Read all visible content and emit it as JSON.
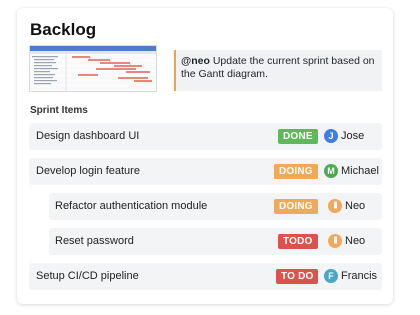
{
  "header": {
    "title": "Backlog"
  },
  "note": {
    "mention": "@neo",
    "text": " Update the current sprint based on the Gantt diagram."
  },
  "section": {
    "title": "Sprint Items"
  },
  "items": [
    {
      "label": "Design dashboard UI",
      "status": "DONE",
      "avatar": "J",
      "assignee": "Jose"
    },
    {
      "label": "Develop login feature",
      "status": "DOING",
      "avatar": "M",
      "assignee": "Michael"
    },
    {
      "label": "Refactor authentication module",
      "status": "DOING",
      "avatar": "|||",
      "assignee": "Neo"
    },
    {
      "label": "Reset password",
      "status": "TODO",
      "avatar": "|||",
      "assignee": "Neo"
    },
    {
      "label": "Setup CI/CD pipeline",
      "status": "TO DO",
      "avatar": "F",
      "assignee": "Francis"
    }
  ],
  "colors": {
    "done": "#5fb85c",
    "doing": "#f0a95a",
    "todo": "#d9534f",
    "avatar_jose": "#3f7fe0",
    "avatar_michael": "#4ea853",
    "avatar_neo": "#f0a95a",
    "avatar_francis": "#4aa6c4",
    "note_accent": "#f0a24a"
  },
  "icons": {
    "thumbnail": "gantt-chart-thumbnail"
  }
}
